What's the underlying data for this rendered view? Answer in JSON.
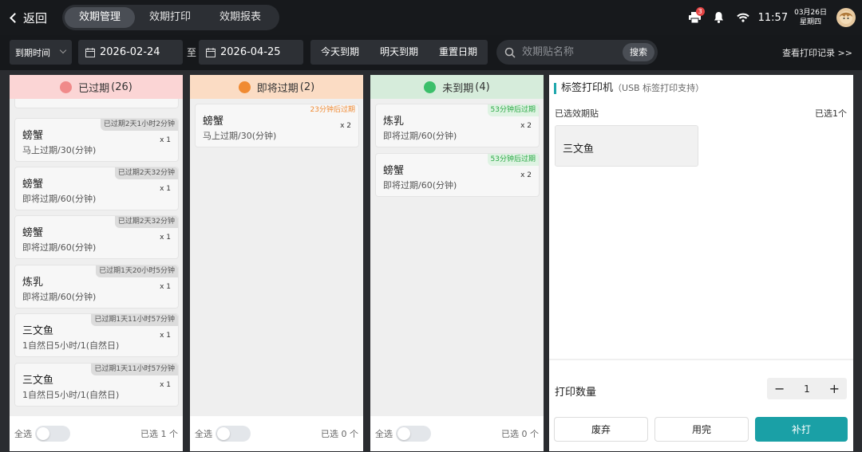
{
  "topbar": {
    "back_label": "返回",
    "tabs": [
      {
        "label": "效期管理",
        "active": true
      },
      {
        "label": "效期打印",
        "active": false
      },
      {
        "label": "效期报表",
        "active": false
      }
    ],
    "printer_badge": "3",
    "time": "11:57",
    "date": "03月26日",
    "weekday": "星期四"
  },
  "filter": {
    "type_select": "到期时间",
    "start_date": "2026-02-24",
    "to_label": "至",
    "end_date": "2026-04-25",
    "quick": [
      "今天到期",
      "明天到期",
      "重置日期"
    ],
    "search_placeholder": "效期贴名称",
    "search_button": "搜索",
    "view_log": "查看打印记录 >>"
  },
  "columns": [
    {
      "title": "已过期",
      "count": "(26)",
      "color": "#fbd5d5",
      "icon_color": "#f08a8a",
      "items": [
        {
          "name": "螃蟹",
          "desc": "马上过期/30(分钟)",
          "qty": "x 1",
          "tag": "已过期2天1小时2分钟"
        },
        {
          "name": "螃蟹",
          "desc": "即将过期/60(分钟)",
          "qty": "x 1",
          "tag": "已过期2天32分钟"
        },
        {
          "name": "螃蟹",
          "desc": "即将过期/60(分钟)",
          "qty": "x 1",
          "tag": "已过期2天32分钟"
        },
        {
          "name": "炼乳",
          "desc": "即将过期/60(分钟)",
          "qty": "x 1",
          "tag": "已过期1天20小时5分钟"
        },
        {
          "name": "三文鱼",
          "desc": "1自然日5小时/1(自然日)",
          "qty": "x 1",
          "tag": "已过期1天11小时57分钟"
        },
        {
          "name": "三文鱼",
          "desc": "1自然日5小时/1(自然日)",
          "qty": "x 1",
          "tag": "已过期1天11小时57分钟"
        }
      ],
      "select_all": "全选",
      "selected": "已选 1 个"
    },
    {
      "title": "即将过期",
      "count": "(2)",
      "color": "#fbdcc4",
      "icon_color": "#f08a32",
      "items": [
        {
          "name": "螃蟹",
          "desc": "马上过期/30(分钟)",
          "qty": "x 2",
          "tag": "23分钟后过期"
        }
      ],
      "select_all": "全选",
      "selected": "已选 0 个"
    },
    {
      "title": "未到期",
      "count": "(4)",
      "color": "#d6ecdb",
      "icon_color": "#3bbf6a",
      "items": [
        {
          "name": "炼乳",
          "desc": "即将过期/60(分钟)",
          "qty": "x 2",
          "tag": "53分钟后过期"
        },
        {
          "name": "螃蟹",
          "desc": "即将过期/60(分钟)",
          "qty": "x 2",
          "tag": "53分钟后过期"
        }
      ],
      "select_all": "全选",
      "selected": "已选 0 个"
    }
  ],
  "printer": {
    "title": "标签打印机",
    "subtitle": "（USB 标签打印支持）",
    "selected_label": "已选效期贴",
    "selected_count": "已选1个",
    "selected_item": "三文鱼",
    "print_qty_label": "打印数量",
    "qty_minus": "−",
    "qty_value": "1",
    "qty_plus": "+",
    "buttons": [
      "废弃",
      "用完",
      "补打"
    ],
    "accent": "#1aa0a6"
  }
}
